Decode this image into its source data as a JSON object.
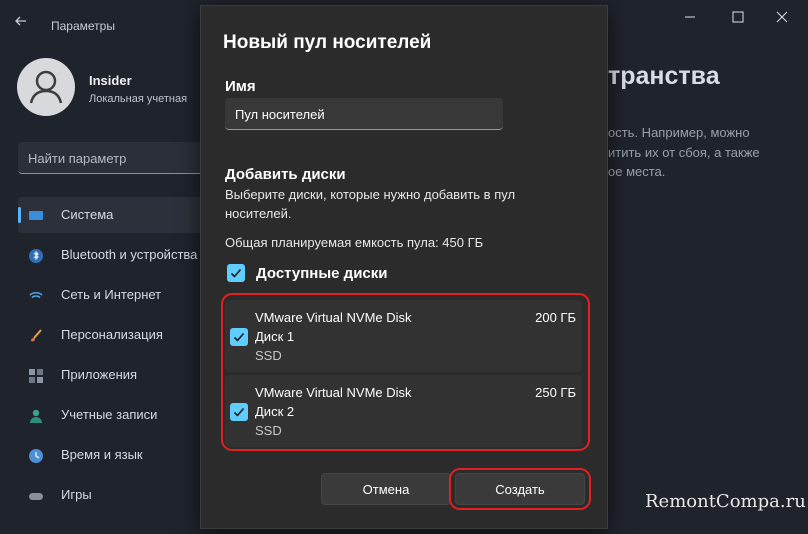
{
  "settings": {
    "app_title": "Параметры",
    "user": {
      "name": "Insider",
      "account_type": "Локальная учетная"
    },
    "search_placeholder": "Найти параметр",
    "nav": [
      {
        "label": "Система",
        "icon": "monitor-icon",
        "selected": true
      },
      {
        "label": "Bluetooth и устройства",
        "icon": "bluetooth-icon"
      },
      {
        "label": "Сеть и Интернет",
        "icon": "wifi-icon"
      },
      {
        "label": "Персонализация",
        "icon": "brush-icon"
      },
      {
        "label": "Приложения",
        "icon": "apps-icon"
      },
      {
        "label": "Учетные записи",
        "icon": "person-icon"
      },
      {
        "label": "Время и язык",
        "icon": "globe-clock-icon"
      },
      {
        "label": "Игры",
        "icon": "gamepad-icon"
      }
    ],
    "page_heading_fragment": "транства",
    "page_desc_lines": [
      "ость. Например, можно",
      "итить их от сбоя, а также",
      "ое места."
    ]
  },
  "dialog": {
    "title": "Новый пул носителей",
    "name_label": "Имя",
    "name_value": "Пул носителей",
    "add_disks_label": "Добавить диски",
    "add_disks_hint": "Выберите диски, которые нужно добавить в пул носителей.",
    "capacity_text": "Общая планируемая емкость пула: 450 ГБ",
    "available_disks_label": "Доступные диски",
    "available_disks_checked": true,
    "disks": [
      {
        "name": "VMware Virtual NVMe Disk",
        "label": "Диск 1",
        "type": "SSD",
        "size": "200 ГБ",
        "checked": true
      },
      {
        "name": "VMware Virtual NVMe Disk",
        "label": "Диск 2",
        "type": "SSD",
        "size": "250 ГБ",
        "checked": true
      }
    ],
    "cancel_label": "Отмена",
    "create_label": "Создать"
  },
  "watermark": "RemontCompa.ru",
  "colors": {
    "accent": "#60cdff",
    "highlight": "#e12121",
    "dialog_bg": "#2b2b2b"
  }
}
